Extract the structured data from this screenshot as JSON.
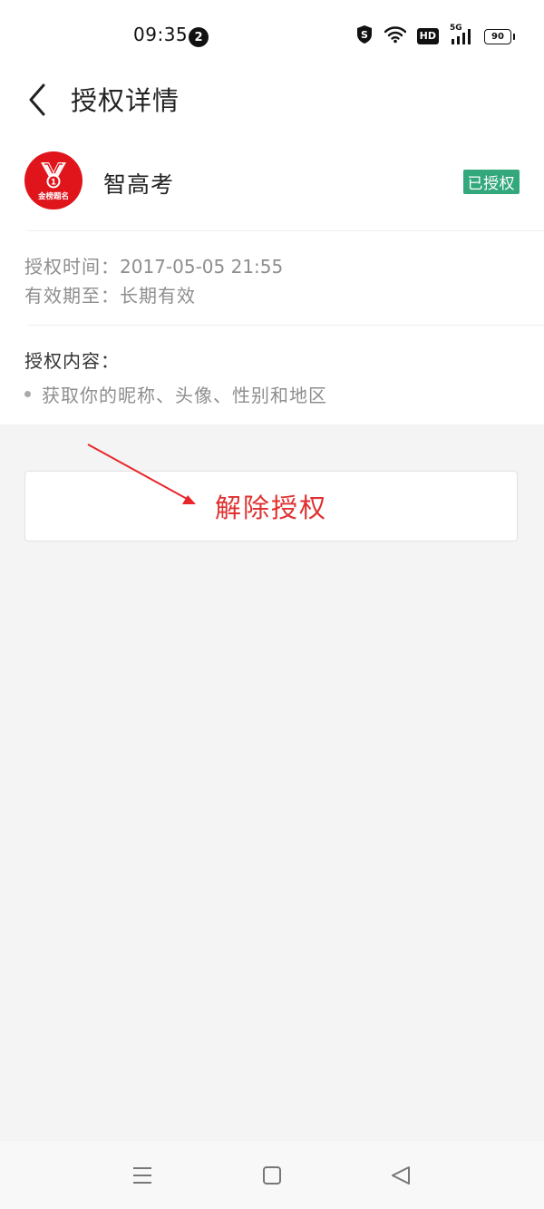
{
  "status_bar": {
    "time": "09:35",
    "notification_count": "2",
    "network": "5G",
    "hd": "HD",
    "battery": "90",
    "icons": [
      "shield-s-icon",
      "wifi-icon",
      "hd-icon",
      "signal-5g-icon",
      "battery-icon"
    ]
  },
  "header": {
    "title": "授权详情",
    "back_icon": "chevron-left-icon"
  },
  "app": {
    "name": "智高考",
    "logo_text": "金榜题名",
    "logo_rank": "1",
    "status": "已授权",
    "status_color": "#33a87d"
  },
  "auth_info": {
    "time_label": "授权时间：",
    "time_value": "2017-05-05 21:55",
    "validity_label": "有效期至：",
    "validity_value": "长期有效"
  },
  "content": {
    "title": "授权内容：",
    "items": [
      "获取你的昵称、头像、性别和地区"
    ]
  },
  "actions": {
    "revoke_label": "解除授权",
    "revoke_color": "#e03030"
  },
  "nav_bar": {
    "icons": [
      "menu-icon",
      "home-icon",
      "back-triangle-icon"
    ]
  }
}
